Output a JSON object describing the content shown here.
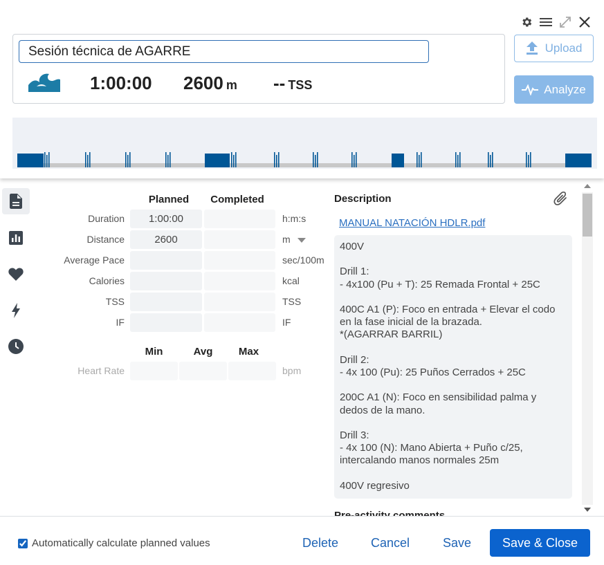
{
  "header": {
    "title_value": "Sesión técnica de AGARRE",
    "duration": "1:00:00",
    "distance_value": "2600",
    "distance_unit": "m",
    "tss_value": "--",
    "tss_unit": "TSS",
    "sport_icon": "swim-wave-icon",
    "upload_label": "Upload",
    "analyze_label": "Analyze",
    "window_controls": [
      "gear-icon",
      "menu-icon",
      "expand-icon",
      "close-icon"
    ]
  },
  "side_nav": [
    "document-icon",
    "chart-icon",
    "heart-icon",
    "lightning-icon",
    "clock-icon"
  ],
  "stats": {
    "planned_header": "Planned",
    "completed_header": "Completed",
    "rows": [
      {
        "label": "Duration",
        "planned": "1:00:00",
        "completed": "",
        "unit": "h:m:s"
      },
      {
        "label": "Distance",
        "planned": "2600",
        "completed": "",
        "unit": "m"
      },
      {
        "label": "Average Pace",
        "planned": "",
        "completed": "",
        "unit": "sec/100m"
      },
      {
        "label": "Calories",
        "planned": "",
        "completed": "",
        "unit": "kcal"
      },
      {
        "label": "TSS",
        "planned": "",
        "completed": "",
        "unit": "TSS"
      },
      {
        "label": "IF",
        "planned": "",
        "completed": "",
        "unit": "IF"
      }
    ],
    "hr_headers": {
      "min": "Min",
      "avg": "Avg",
      "max": "Max"
    },
    "hr_label": "Heart Rate",
    "hr_unit": "bpm"
  },
  "description": {
    "title": "Description",
    "attachment": "MANUAL NATACIÓN HDLR.pdf",
    "text": "400V\n\nDrill 1:\n- 4x100 (Pu + T): 25 Remada Frontal + 25C\n\n400C A1 (P): Foco en entrada + Elevar el codo en la fase inicial de la brazada.\n*(AGARRAR BARRIL)\n\nDrill 2:\n- 4x 100 (Pu): 25 Puños Cerrados + 25C\n\n200C A1 (N): Foco en sensibilidad palma y dedos de la mano.\n\nDrill 3:\n- 4x 100 (N): Mano Abierta + Puño c/25, intercalando manos normales 25m\n\n400V regresivo",
    "pre_activity_title": "Pre-activity comments"
  },
  "footer": {
    "auto_calc_label": "Automatically calculate planned values",
    "auto_calc_checked": true,
    "delete_label": "Delete",
    "cancel_label": "Cancel",
    "save_label": "Save",
    "save_close_label": "Save & Close"
  },
  "colors": {
    "accent": "#0b63ce",
    "graph_bar": "#005696",
    "graph_baseline": "#c8c8c8",
    "graph_bg": "#eef1f6",
    "sport_icon": "#1c7ca6"
  }
}
